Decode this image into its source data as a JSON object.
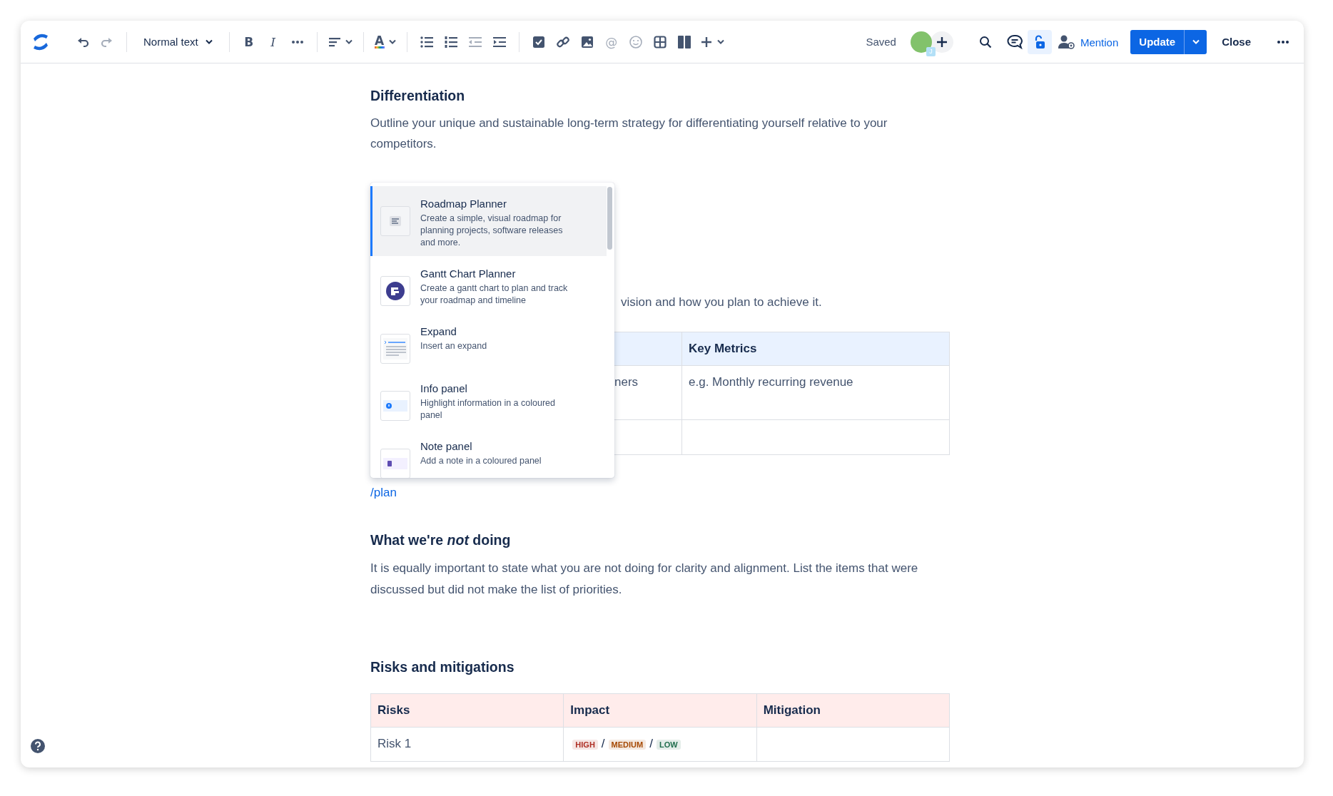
{
  "toolbar": {
    "tools": [
      {
        "kind": "undo",
        "disabled": false
      },
      {
        "kind": "redo",
        "disabled": true
      },
      {
        "kind": "divider"
      },
      {
        "kind": "text_style",
        "label": "Normal text"
      },
      {
        "kind": "divider"
      },
      {
        "kind": "bold",
        "glyph": "B"
      },
      {
        "kind": "italic",
        "glyph": "I"
      },
      {
        "kind": "more"
      },
      {
        "kind": "divider"
      },
      {
        "kind": "align"
      },
      {
        "kind": "divider"
      },
      {
        "kind": "text_color",
        "glyph": "A"
      },
      {
        "kind": "divider"
      },
      {
        "kind": "bullets",
        "disabled": false
      },
      {
        "kind": "numbers",
        "disabled": false
      },
      {
        "kind": "outdent",
        "disabled": true
      },
      {
        "kind": "indent",
        "disabled": false
      },
      {
        "kind": "divider"
      },
      {
        "kind": "task"
      },
      {
        "kind": "link"
      },
      {
        "kind": "image"
      },
      {
        "kind": "mention",
        "glyph": "@",
        "disabled": true
      },
      {
        "kind": "emoji",
        "disabled": true
      },
      {
        "kind": "table"
      },
      {
        "kind": "layout"
      },
      {
        "kind": "insert"
      }
    ],
    "status": "Saved",
    "avatar_badge": "J",
    "restrictions_selected": true,
    "mention": "Mention",
    "update": "Update",
    "close": "Close"
  },
  "differentiation": {
    "heading": "Differentiation",
    "body": "Outline your unique and sustainable long-term strategy for differentiating yourself relative to your competitors."
  },
  "vision": {
    "body_visible": "vision and how you plan to achieve it.",
    "table": {
      "header": "Key Metrics",
      "rows": [
        {
          "column_1": "ners",
          "key_metrics": "e.g. Monthly recurring revenue"
        },
        {}
      ]
    }
  },
  "slash_menu": {
    "items": [
      {
        "kind": "roadmap",
        "title": "Roadmap Planner",
        "description": "Create a simple, visual roadmap for planning projects, software releases and more.",
        "selected": true
      },
      {
        "kind": "gantt",
        "title": "Gantt Chart Planner",
        "description": "Create a gantt chart to plan and track your roadmap and timeline",
        "selected": false
      },
      {
        "kind": "expand",
        "title": "Expand",
        "description": "Insert an expand",
        "selected": false
      },
      {
        "kind": "info",
        "title": "Info panel",
        "description": "Highlight information in a coloured panel",
        "selected": false
      },
      {
        "kind": "note",
        "title": "Note panel",
        "description": "Add a note in a coloured panel",
        "selected": false
      }
    ]
  },
  "query": "/plan",
  "not_doing": {
    "heading": "What we're *not* doing",
    "body": "It is equally important to state what you are not doing for clarity and alignment. List the items that were discussed but did not make the list of priorities."
  },
  "risks": {
    "heading": "Risks and mitigations",
    "table": {
      "columns": [
        "Risks",
        "Impact",
        "Mitigation"
      ],
      "rows": [
        {
          "risks": "Risk 1",
          "impact": [
            {
              "kind": "badge",
              "text": "HIGH",
              "color": "#ae2e24"
            },
            {
              "kind": "text",
              "text": "/"
            },
            {
              "kind": "badge",
              "text": "MEDIUM",
              "color": "#a54800"
            },
            {
              "kind": "text",
              "text": "/"
            },
            {
              "kind": "badge",
              "text": "LOW",
              "color": "#216e4e"
            }
          ]
        }
      ]
    }
  }
}
